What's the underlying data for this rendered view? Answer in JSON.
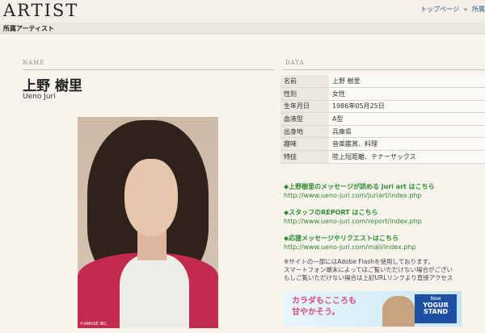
{
  "header": {
    "site_title": "ARTIST",
    "nav": [
      "トップページ",
      "所属"
    ],
    "nav_separator": "»"
  },
  "subheader": {
    "title": "所属アーティスト"
  },
  "name_section": {
    "label": "NAME",
    "name_jp": "上野 樹里",
    "name_en": "Ueno Juri"
  },
  "photo": {
    "credit": "©AMUSE INC."
  },
  "data_section": {
    "label": "DATA",
    "rows": [
      {
        "key": "名前",
        "value": "上野 樹里"
      },
      {
        "key": "性別",
        "value": "女性"
      },
      {
        "key": "生年月日",
        "value": "1986年05月25日"
      },
      {
        "key": "血液型",
        "value": "A型"
      },
      {
        "key": "出身地",
        "value": "兵庫県"
      },
      {
        "key": "趣味",
        "value": "音楽鑑賞、料理"
      },
      {
        "key": "特技",
        "value": "陸上短距離、テナーサックス"
      }
    ]
  },
  "links": [
    {
      "title": "◆上野樹里のメッセージが読める juri art はこちら",
      "url": "http://www.ueno-juri.com/juriart/index.php"
    },
    {
      "title": "◆スタッフのREPORT はこちら",
      "url": "http://www.ueno-juri.com/report/index.php"
    },
    {
      "title": "◆応援メッセージやリクエストはこちら",
      "url": "http://www.ueno-juri.com/mail/index.php"
    }
  ],
  "notice": [
    "※サイトの一部にはAdobe Flashを使用しております。",
    "スマートフォン端末によってはご覧いただけない場合がござい",
    "もしご覧いただけない場合は上記URLリンクより直接アクセス"
  ],
  "banner": {
    "text_line1": "カラダもこころも",
    "text_line2": "甘やかそう。",
    "logo_top": "New",
    "logo_main": "YOGUR STAND"
  }
}
